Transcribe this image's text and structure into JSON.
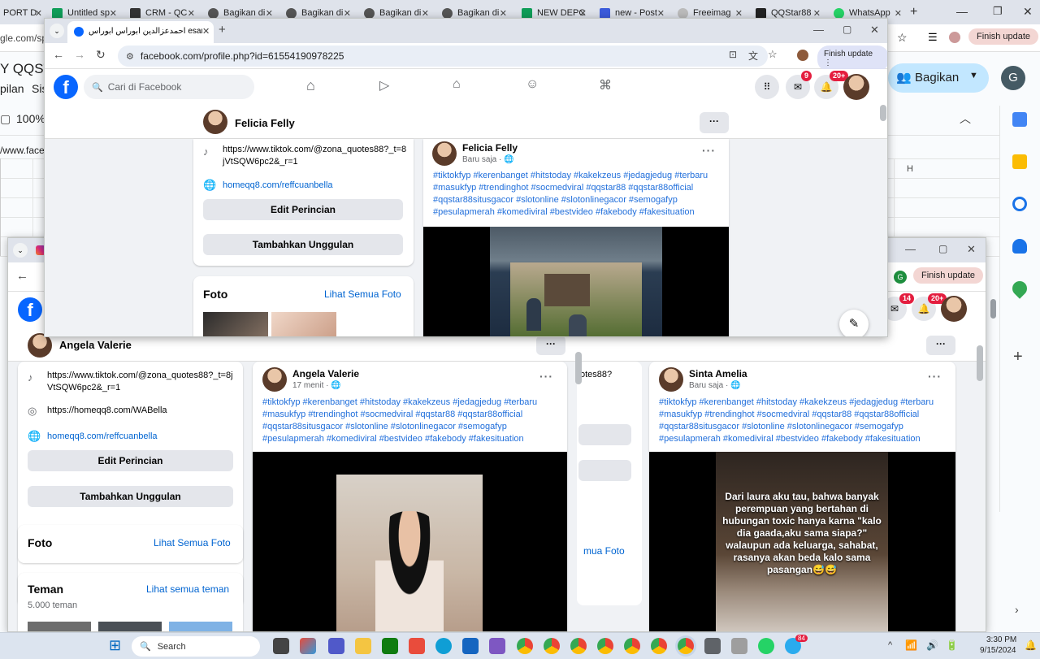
{
  "background": {
    "tabs": [
      "PORT D",
      "Untitled sp",
      "CRM - QC",
      "Bagikan di",
      "Bagikan di",
      "Bagikan di",
      "Bagikan di",
      "NEW DEPC",
      "new - Post",
      "Freeimag",
      "QQStar88",
      "WhatsApp"
    ],
    "url_fragment": "gle.com/spre",
    "sheet_title": "Y QQST",
    "menu_fragment": "pilan",
    "menu_fragment2": "Sis",
    "zoom": "100%",
    "cell_text": "/www.face",
    "column_h": "H",
    "share_label": "Bagikan",
    "account_initial": "G",
    "finish_update": "Finish update"
  },
  "window1": {
    "tab_title": "احمدعزالدین ابوراس ابوراس ‎esan",
    "url": "facebook.com/profile.php?id=61554190978225",
    "finish_update": "Finish update",
    "search_placeholder": "Cari di Facebook",
    "messenger_badge": "9",
    "notif_badge": "20+",
    "profile_name": "Felicia Felly",
    "tiktok_link": "https://www.tiktok.com/@zona_quotes88?_t=8jVtSQW6pc2&_r=1",
    "website": "homeqq8.com/reffcuanbella",
    "edit_details": "Edit Perincian",
    "add_featured": "Tambahkan Unggulan",
    "photos_title": "Foto",
    "see_all_photos": "Lihat Semua Foto",
    "post": {
      "author": "Felicia Felly",
      "time": "Baru saja",
      "hashtags": "#tiktokfyp #kerenbanget #hitstoday #kakekzeus #jedagjedug #terbaru #masukfyp #trendinghot #socmedviral #qqstar88 #qqstar88official #qqstar88situsgacor #slotonline #slotonlinegacor #semogafyp #pesulapmerah #komediviral #bestvideo #fakebody #fakesituation"
    }
  },
  "window2": {
    "finish_update": "Finish update",
    "account_initial": "G",
    "messenger_badge": "14",
    "notif_badge": "20+",
    "profile_name": "Angela Valerie",
    "tiktok_link": "https://www.tiktok.com/@zona_quotes88?_t=8jVtSQW6pc2&_r=1",
    "whatsapp_link": "https://homeqq8.com/WABella",
    "website": "homeqq8.com/reffcuanbella",
    "edit_details": "Edit Perincian",
    "add_featured": "Tambahkan Unggulan",
    "photos_title": "Foto",
    "see_all_photos": "Lihat Semua Foto",
    "friends_title": "Teman",
    "see_all_friends": "Lihat semua teman",
    "friends_count": "5.000 teman",
    "behind_fragment": "otes88?",
    "behind_fragment2": "mua Foto",
    "post1": {
      "author": "Angela Valerie",
      "time": "17 menit",
      "hashtags": "#tiktokfyp #kerenbanget #hitstoday #kakekzeus #jedagjedug #terbaru #masukfyp #trendinghot #socmedviral #qqstar88 #qqstar88official #qqstar88situsgacor #slotonline #slotonlinegacor #semogafyp #pesulapmerah #komediviral #bestvideo #fakebody #fakesituation"
    },
    "post2": {
      "author": "Sinta Amelia",
      "time": "Baru saja",
      "hashtags": "#tiktokfyp #kerenbanget #hitstoday #kakekzeus #jedagjedug #terbaru #masukfyp #trendinghot #socmedviral #qqstar88 #qqstar88official #qqstar88situsgacor #slotonline #slotonlinegacor #semogafyp #pesulapmerah #komediviral #bestvideo #fakebody #fakesituation",
      "overlay_text": "Dari laura aku tau, bahwa banyak perempuan yang bertahan di hubungan toxic hanya karna \"kalo dia gaada,aku sama siapa?\" walaupun ada keluarga, sahabat, rasanya akan beda kalo sama pasangan😅😅"
    }
  },
  "taskbar": {
    "search": "Search",
    "time": "3:30 PM",
    "date": "9/15/2024",
    "notif_count": "84"
  }
}
